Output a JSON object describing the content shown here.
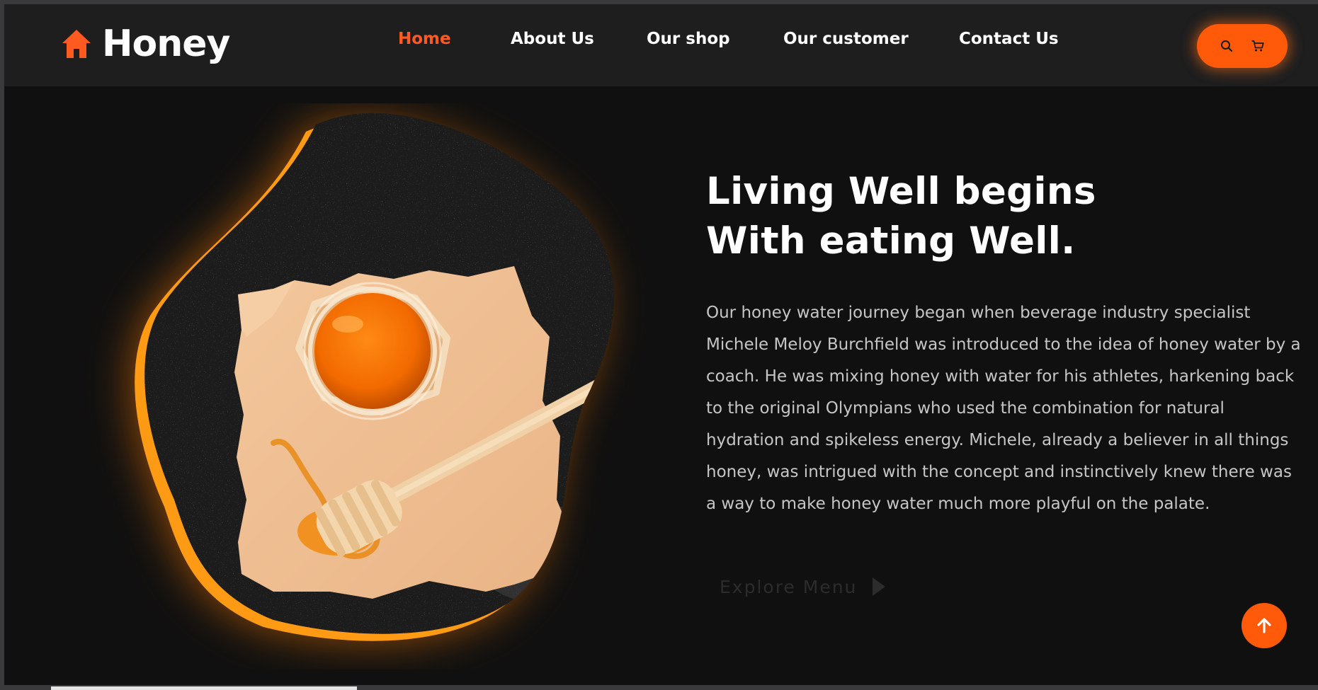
{
  "brand": {
    "name": "Honey",
    "icon": "home-icon",
    "accent_color": "#ff5a1f"
  },
  "nav": {
    "items": [
      {
        "label": "Home",
        "active": true
      },
      {
        "label": "About Us",
        "active": false
      },
      {
        "label": "Our shop",
        "active": false
      },
      {
        "label": "Our customer",
        "active": false
      },
      {
        "label": "Contact Us",
        "active": false
      }
    ]
  },
  "header_actions": {
    "icons": [
      "search-icon",
      "cart-icon"
    ],
    "color": "#ff5a0a"
  },
  "hero": {
    "headline_line1": "Living Well begins",
    "headline_line2": "With eating Well.",
    "description": "Our honey water journey began when beverage industry specialist Michele Meloy Burchfield was introduced to the idea of honey water by a coach. He was mixing honey with water for his athletes, harkening back to the original Olympians who used the combination for natural hydration and spikeless energy. Michele, already a believer in all things honey, was intrigued with the concept and instinctively knew there was a way to make honey water much more playful on the palate.",
    "cta_label": "Explore Menu",
    "cta_icon": "play-icon",
    "image_subject": "honey-jar-on-paper-image"
  },
  "scroll_top": {
    "icon": "arrow-up-icon"
  },
  "colors": {
    "background": "#101010",
    "navbar": "#1e1e1f",
    "accent": "#ff5a0a",
    "ring": "#ff9a14"
  }
}
